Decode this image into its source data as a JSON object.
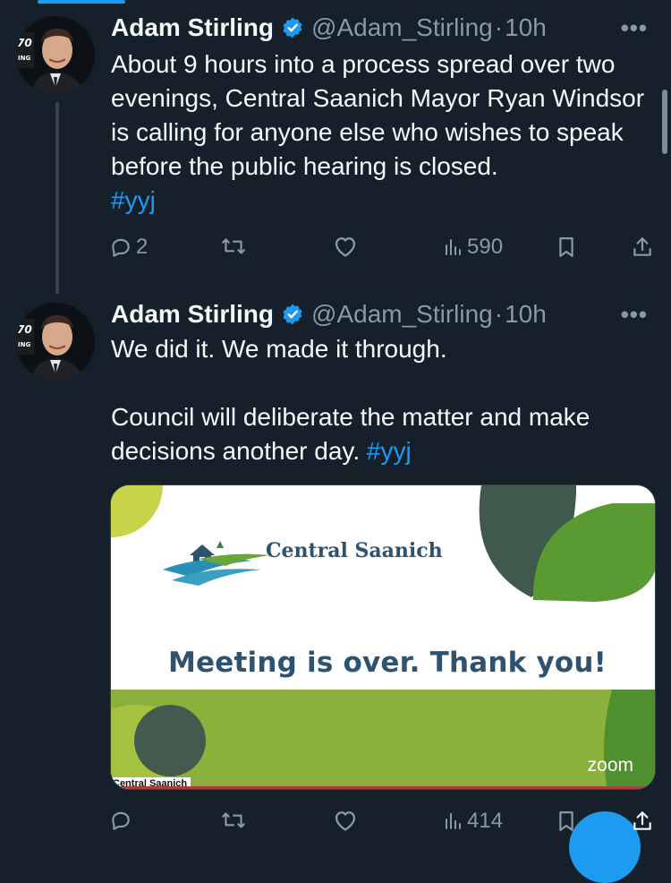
{
  "tweets": [
    {
      "name": "Adam Stirling",
      "handle": "@Adam_Stirling",
      "dot": "·",
      "time": "10h",
      "more": "•••",
      "text": "About 9 hours into a process spread over two evenings, Central Saanich Mayor Ryan Windsor is calling for anyone else who wishes to speak before the public hearing is closed.",
      "hashtag": "#yyj",
      "replies": "2",
      "views": "590"
    },
    {
      "name": "Adam Stirling",
      "handle": "@Adam_Stirling",
      "dot": "·",
      "time": "10h",
      "more": "•••",
      "text": "We did it. We made it through.\n\nCouncil will deliberate the matter and make decisions another day. ",
      "hashtag": "#yyj",
      "views": "414",
      "media": {
        "brand": "Central Saanich",
        "title": "Meeting is over. Thank you!",
        "zoom": "zoom",
        "caption": "Central Saanich"
      }
    }
  ],
  "colors": {
    "background": "#15202b",
    "accent": "#1d9bf0",
    "muted": "#8b98a5",
    "slide_navy": "#2e5370",
    "slide_green": "#8bb13c"
  },
  "icons": [
    "verified-badge-icon",
    "more-icon",
    "reply-icon",
    "retweet-icon",
    "like-icon",
    "views-icon",
    "bookmark-icon",
    "share-icon"
  ]
}
